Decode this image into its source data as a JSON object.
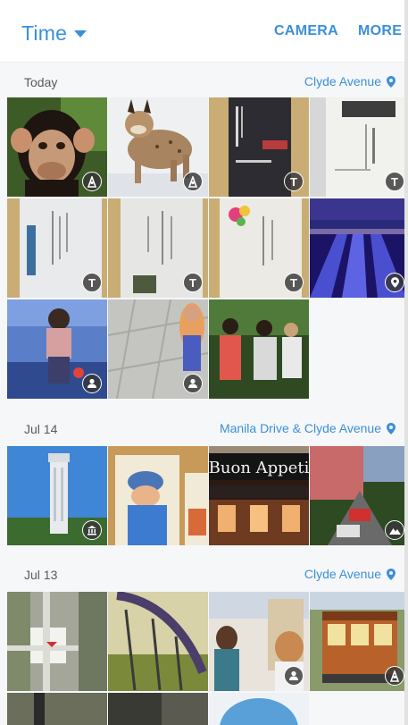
{
  "header": {
    "view_label": "Time",
    "camera_label": "CAMERA",
    "more_label": "MORE"
  },
  "colors": {
    "accent": "#3b8fd9",
    "date_text": "#555b61",
    "background": "#f6f7f9"
  },
  "sections": [
    {
      "date": "Today",
      "location": "Clyde Avenue",
      "photos": [
        {
          "subject": "chimpanzee",
          "badge": "scene-icon"
        },
        {
          "subject": "lynx in snow",
          "badge": "scene-icon"
        },
        {
          "subject": "business card",
          "badge": "text-icon",
          "badge_text": "T"
        },
        {
          "subject": "business card",
          "badge": "text-icon",
          "badge_text": "T"
        },
        {
          "subject": "business card",
          "badge": "text-icon",
          "badge_text": "T"
        },
        {
          "subject": "business card",
          "badge": "text-icon",
          "badge_text": "T"
        },
        {
          "subject": "business card",
          "badge": "text-icon",
          "badge_text": "T"
        },
        {
          "subject": "bowling lanes",
          "badge": "location-icon"
        },
        {
          "subject": "bowling player",
          "badge": "person-icon"
        },
        {
          "subject": "child on tiles",
          "badge": "person-icon"
        },
        {
          "subject": "people in park",
          "badge": "none"
        }
      ]
    },
    {
      "date": "Jul 14",
      "location": "Manila Drive & Clyde Avenue",
      "photos": [
        {
          "subject": "coit tower",
          "badge": "landmark-icon"
        },
        {
          "subject": "cartoon drawing",
          "badge": "none"
        },
        {
          "subject": "restaurant sign",
          "badge": "none",
          "sign_text": "Buon Appeti"
        },
        {
          "subject": "street with cars",
          "badge": "mountain-icon"
        }
      ]
    },
    {
      "date": "Jul 13",
      "location": "Clyde Avenue",
      "photos": [
        {
          "subject": "map",
          "badge": "none"
        },
        {
          "subject": "roller coaster",
          "badge": "none"
        },
        {
          "subject": "women in store",
          "badge": "person-icon"
        },
        {
          "subject": "cable car",
          "badge": "scene-icon"
        }
      ]
    }
  ]
}
